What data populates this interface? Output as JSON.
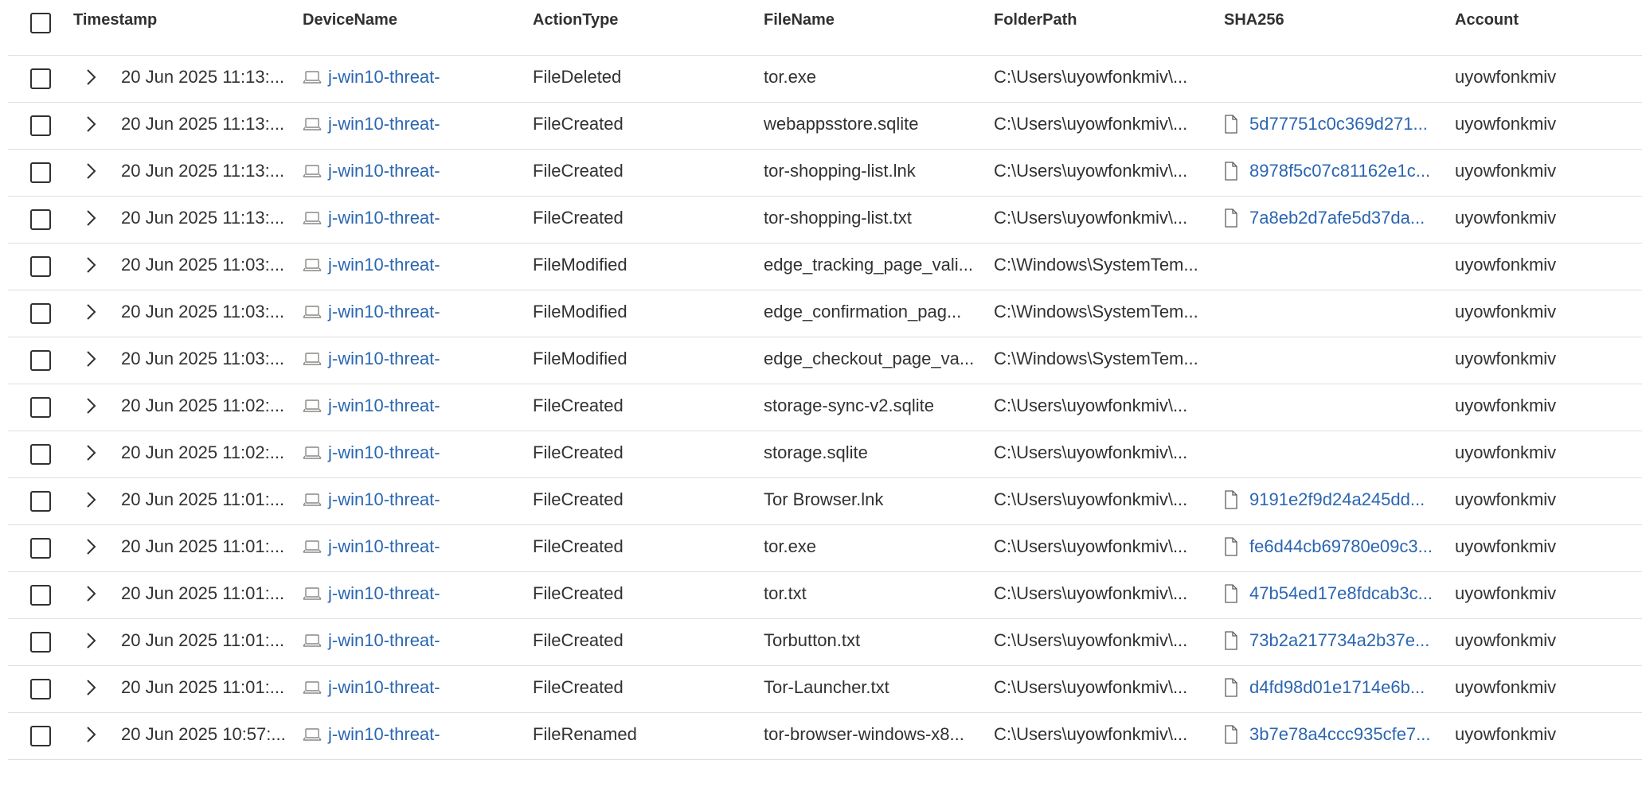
{
  "columns": {
    "timestamp": "Timestamp",
    "device": "DeviceName",
    "action": "ActionType",
    "file": "FileName",
    "folder": "FolderPath",
    "sha": "SHA256",
    "account": "Account"
  },
  "icons": {
    "device": "laptop-icon",
    "file": "document-icon",
    "expand": "chevron-right-icon"
  },
  "colors": {
    "link": "#2b66b1",
    "border": "#e1dfdd"
  },
  "rows": [
    {
      "timestamp": "20 Jun 2025 11:13:...",
      "device": "j-win10-threat-",
      "action": "FileDeleted",
      "file": "tor.exe",
      "folder": "C:\\Users\\uyowfonkmiv\\...",
      "sha": "",
      "account": "uyowfonkmiv"
    },
    {
      "timestamp": "20 Jun 2025 11:13:...",
      "device": "j-win10-threat-",
      "action": "FileCreated",
      "file": "webappsstore.sqlite",
      "folder": "C:\\Users\\uyowfonkmiv\\...",
      "sha": "5d77751c0c369d271...",
      "account": "uyowfonkmiv"
    },
    {
      "timestamp": "20 Jun 2025 11:13:...",
      "device": "j-win10-threat-",
      "action": "FileCreated",
      "file": "tor-shopping-list.lnk",
      "folder": "C:\\Users\\uyowfonkmiv\\...",
      "sha": "8978f5c07c81162e1c...",
      "account": "uyowfonkmiv"
    },
    {
      "timestamp": "20 Jun 2025 11:13:...",
      "device": "j-win10-threat-",
      "action": "FileCreated",
      "file": "tor-shopping-list.txt",
      "folder": "C:\\Users\\uyowfonkmiv\\...",
      "sha": "7a8eb2d7afe5d37da...",
      "account": "uyowfonkmiv"
    },
    {
      "timestamp": "20 Jun 2025 11:03:...",
      "device": "j-win10-threat-",
      "action": "FileModified",
      "file": "edge_tracking_page_vali...",
      "folder": "C:\\Windows\\SystemTem...",
      "sha": "",
      "account": "uyowfonkmiv"
    },
    {
      "timestamp": "20 Jun 2025 11:03:...",
      "device": "j-win10-threat-",
      "action": "FileModified",
      "file": "edge_confirmation_pag...",
      "folder": "C:\\Windows\\SystemTem...",
      "sha": "",
      "account": "uyowfonkmiv"
    },
    {
      "timestamp": "20 Jun 2025 11:03:...",
      "device": "j-win10-threat-",
      "action": "FileModified",
      "file": "edge_checkout_page_va...",
      "folder": "C:\\Windows\\SystemTem...",
      "sha": "",
      "account": "uyowfonkmiv"
    },
    {
      "timestamp": "20 Jun 2025 11:02:...",
      "device": "j-win10-threat-",
      "action": "FileCreated",
      "file": "storage-sync-v2.sqlite",
      "folder": "C:\\Users\\uyowfonkmiv\\...",
      "sha": "",
      "account": "uyowfonkmiv"
    },
    {
      "timestamp": "20 Jun 2025 11:02:...",
      "device": "j-win10-threat-",
      "action": "FileCreated",
      "file": "storage.sqlite",
      "folder": "C:\\Users\\uyowfonkmiv\\...",
      "sha": "",
      "account": "uyowfonkmiv"
    },
    {
      "timestamp": "20 Jun 2025 11:01:...",
      "device": "j-win10-threat-",
      "action": "FileCreated",
      "file": "Tor Browser.lnk",
      "folder": "C:\\Users\\uyowfonkmiv\\...",
      "sha": "9191e2f9d24a245dd...",
      "account": "uyowfonkmiv"
    },
    {
      "timestamp": "20 Jun 2025 11:01:...",
      "device": "j-win10-threat-",
      "action": "FileCreated",
      "file": "tor.exe",
      "folder": "C:\\Users\\uyowfonkmiv\\...",
      "sha": "fe6d44cb69780e09c3...",
      "account": "uyowfonkmiv"
    },
    {
      "timestamp": "20 Jun 2025 11:01:...",
      "device": "j-win10-threat-",
      "action": "FileCreated",
      "file": "tor.txt",
      "folder": "C:\\Users\\uyowfonkmiv\\...",
      "sha": "47b54ed17e8fdcab3c...",
      "account": "uyowfonkmiv"
    },
    {
      "timestamp": "20 Jun 2025 11:01:...",
      "device": "j-win10-threat-",
      "action": "FileCreated",
      "file": "Torbutton.txt",
      "folder": "C:\\Users\\uyowfonkmiv\\...",
      "sha": "73b2a217734a2b37e...",
      "account": "uyowfonkmiv"
    },
    {
      "timestamp": "20 Jun 2025 11:01:...",
      "device": "j-win10-threat-",
      "action": "FileCreated",
      "file": "Tor-Launcher.txt",
      "folder": "C:\\Users\\uyowfonkmiv\\...",
      "sha": "d4fd98d01e1714e6b...",
      "account": "uyowfonkmiv"
    },
    {
      "timestamp": "20 Jun 2025 10:57:...",
      "device": "j-win10-threat-",
      "action": "FileRenamed",
      "file": "tor-browser-windows-x8...",
      "folder": "C:\\Users\\uyowfonkmiv\\...",
      "sha": "3b7e78a4ccc935cfe7...",
      "account": "uyowfonkmiv"
    }
  ]
}
